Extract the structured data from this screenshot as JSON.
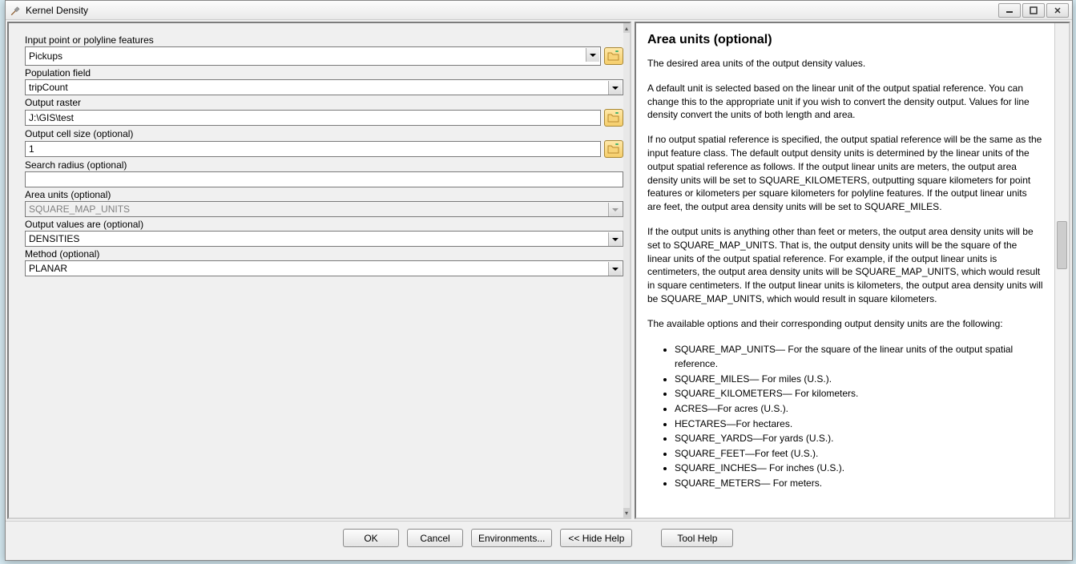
{
  "window": {
    "title": "Kernel Density"
  },
  "form": {
    "input_features": {
      "label": "Input point or polyline features",
      "value": "Pickups"
    },
    "population_field": {
      "label": "Population field",
      "value": "tripCount"
    },
    "output_raster": {
      "label": "Output raster",
      "value": "J:\\GIS\\test"
    },
    "cell_size": {
      "label": "Output cell size (optional)",
      "value": "1"
    },
    "search_radius": {
      "label": "Search radius (optional)",
      "value": ""
    },
    "area_units": {
      "label": "Area units (optional)",
      "value": "SQUARE_MAP_UNITS"
    },
    "output_values": {
      "label": "Output values are (optional)",
      "value": "DENSITIES"
    },
    "method": {
      "label": "Method (optional)",
      "value": "PLANAR"
    }
  },
  "buttons": {
    "ok": "OK",
    "cancel": "Cancel",
    "environments": "Environments...",
    "hide_help": "<< Hide Help",
    "tool_help": "Tool Help"
  },
  "help": {
    "title": "Area units (optional)",
    "p1": "The desired area units of the output density values.",
    "p2": "A default unit is selected based on the linear unit of the output spatial reference. You can change this to the appropriate unit if you wish to convert the density output. Values for line density convert the units of both length and area.",
    "p3": "If no output spatial reference is specified, the output spatial reference will be the same as the input feature class. The default output density units is determined by the linear units of the output spatial reference as follows. If the output linear units are meters, the output area density units will be set to SQUARE_KILOMETERS, outputting square kilometers for point features or kilometers per square kilometers for polyline features. If the output linear units are feet, the output area density units will be set to SQUARE_MILES.",
    "p4": "If the output units is anything other than feet or meters, the output area density units will be set to SQUARE_MAP_UNITS. That is, the output density units will be the square of the linear units of the output spatial reference. For example, if the output linear units is centimeters, the output area density units will be SQUARE_MAP_UNITS, which would result in square centimeters. If the output linear units is kilometers, the output area density units will be SQUARE_MAP_UNITS, which would result in square kilometers.",
    "p5": "The available options and their corresponding output density units are the following:",
    "items": [
      "SQUARE_MAP_UNITS— For the square of the linear units of the output spatial reference.",
      "SQUARE_MILES— For miles (U.S.).",
      "SQUARE_KILOMETERS— For kilometers.",
      "ACRES—For acres (U.S.).",
      "HECTARES—For hectares.",
      "SQUARE_YARDS—For yards (U.S.).",
      "SQUARE_FEET—For feet (U.S.).",
      "SQUARE_INCHES— For inches (U.S.).",
      "SQUARE_METERS— For meters."
    ]
  }
}
